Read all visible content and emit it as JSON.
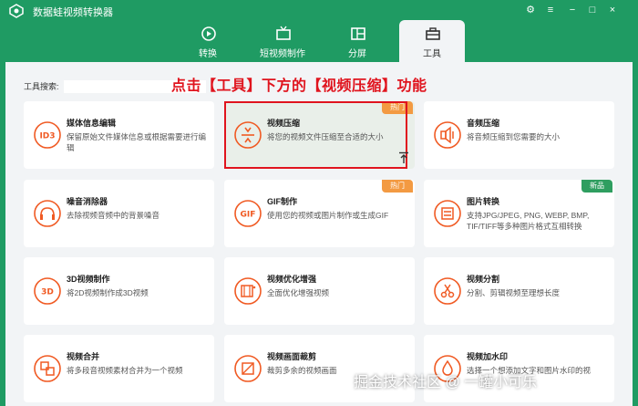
{
  "app": {
    "title": "数据蛙视频转换器"
  },
  "window_controls": {
    "settings": "⚙",
    "menu": "≡",
    "minimize": "−",
    "maximize": "□",
    "close": "×"
  },
  "tabs": [
    {
      "label": "转换",
      "icon": "disc-icon",
      "active": false
    },
    {
      "label": "短视频制作",
      "icon": "tv-icon",
      "active": false
    },
    {
      "label": "分屏",
      "icon": "split-screen-icon",
      "active": false
    },
    {
      "label": "工具",
      "icon": "toolbox-icon",
      "active": true
    }
  ],
  "search": {
    "label": "工具搜索:",
    "value": ""
  },
  "annotation": "点击【工具】下方的【视频压缩】功能",
  "tools": [
    {
      "title": "媒体信息编辑",
      "desc": "保留原始文件媒体信息或根据需要进行编辑",
      "icon": "id3-icon",
      "badge": ""
    },
    {
      "title": "视频压缩",
      "desc": "将您的视频文件压缩至合适的大小",
      "icon": "compress-icon",
      "badge": "热门"
    },
    {
      "title": "音频压缩",
      "desc": "将音频压缩到您需要的大小",
      "icon": "audio-compress-icon",
      "badge": ""
    },
    {
      "title": "噪音消除器",
      "desc": "去除视频音频中的背景噪音",
      "icon": "noise-icon",
      "badge": ""
    },
    {
      "title": "GIF制作",
      "desc": "使用您的视频或图片制作或生成GIF",
      "icon": "gif-icon",
      "badge": "热门"
    },
    {
      "title": "图片转换",
      "desc": "支持JPG/JPEG, PNG, WEBP, BMP, TIF/TIFF等多种图片格式互相转换",
      "icon": "image-convert-icon",
      "badge": "新品"
    },
    {
      "title": "3D视频制作",
      "desc": "将2D视频制作成3D视频",
      "icon": "3d-icon",
      "badge": ""
    },
    {
      "title": "视频优化增强",
      "desc": "全面优化增强视频",
      "icon": "enhance-icon",
      "badge": ""
    },
    {
      "title": "视频分割",
      "desc": "分割、剪辑视频至理想长度",
      "icon": "scissors-icon",
      "badge": ""
    },
    {
      "title": "视频合并",
      "desc": "将多段音视频素材合并为一个视频",
      "icon": "merge-icon",
      "badge": ""
    },
    {
      "title": "视频画面裁剪",
      "desc": "裁剪多余的视频画面",
      "icon": "crop-icon",
      "badge": ""
    },
    {
      "title": "视频加水印",
      "desc": "选择一个想添加文字和图片水印的视",
      "icon": "watermark-icon",
      "badge": ""
    }
  ],
  "watermark": "掘金技术社区 @ 一罐小可乐",
  "colors": {
    "brand": "#1f9b63",
    "accent": "#f05a23",
    "annotation": "#e0141e",
    "hot": "#f39a42",
    "new": "#2f9e60"
  }
}
